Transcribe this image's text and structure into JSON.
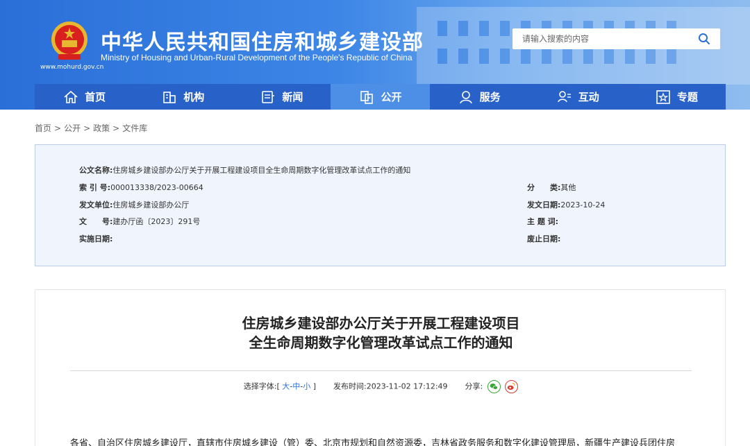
{
  "header": {
    "site_url": "www.mohurd.gov.cn",
    "title": "中华人民共和国住房和城乡建设部",
    "subtitle": "Ministry of Housing and Urban-Rural Development of the People's Republic of China",
    "search_placeholder": "请输入搜索的内容",
    "colors": {
      "header_blue": "#2a6fd8",
      "nav_blue": "#2862c8",
      "nav_active": "#4d8fe6"
    }
  },
  "nav": {
    "items": [
      {
        "label": "首页",
        "icon": "home-icon"
      },
      {
        "label": "机构",
        "icon": "building-icon"
      },
      {
        "label": "新闻",
        "icon": "news-icon"
      },
      {
        "label": "公开",
        "icon": "document-icon",
        "active": true
      },
      {
        "label": "服务",
        "icon": "service-icon"
      },
      {
        "label": "互动",
        "icon": "interaction-icon"
      },
      {
        "label": "专题",
        "icon": "star-icon"
      }
    ]
  },
  "breadcrumb": [
    "首页",
    "公开",
    "政策",
    "文件库"
  ],
  "meta": {
    "doc_name_label": "公文名称:",
    "doc_name_value": "住房城乡建设部办公厅关于开展工程建设项目全生命周期数字化管理改革试点工作的通知",
    "index_label": "索 引 号:",
    "index_value": "000013338/2023-00664",
    "category_label": "分　　类:",
    "category_value": "其他",
    "issuer_label": "发文单位:",
    "issuer_value": "住房城乡建设部办公厅",
    "issue_date_label": "发文日期:",
    "issue_date_value": "2023-10-24",
    "doc_no_label": "文　　号:",
    "doc_no_value": "建办厅函〔2023〕291号",
    "subject_label": "主 题 词:",
    "subject_value": "",
    "effective_label": "实施日期:",
    "effective_value": "",
    "expiry_label": "废止日期:",
    "expiry_value": ""
  },
  "article": {
    "title_line1": "住房城乡建设部办公厅关于开展工程建设项目",
    "title_line2": "全生命周期数字化管理改革试点工作的通知",
    "font_label": "选择字体:",
    "font_open": "[",
    "font_large": "大",
    "font_medium": "中",
    "font_small": "小",
    "font_close": "]",
    "font_dash": "-",
    "publish_label": "发布时间:",
    "publish_time": "2023-11-02 17:12:49",
    "share_label": "分享:",
    "body_first_line": "各省、自治区住房城乡建设厅，直辖市住房城乡建设（管）委、北京市规划和自然资源委，吉林省政务服务和数字化建设管理局，新疆生产建设兵团住房"
  }
}
